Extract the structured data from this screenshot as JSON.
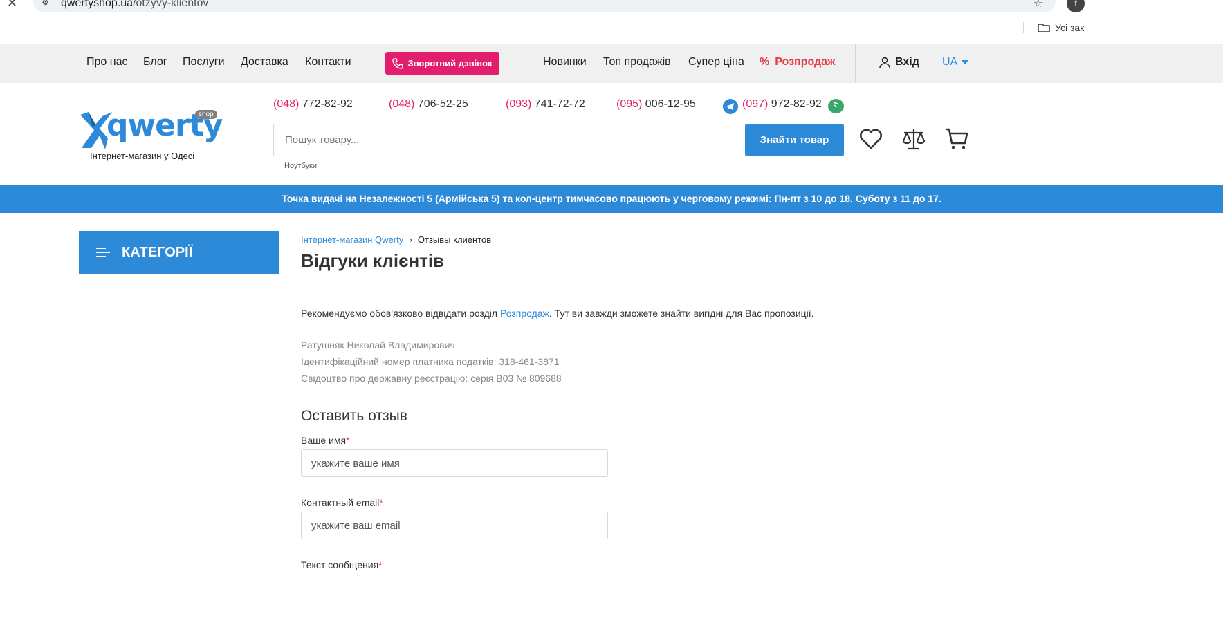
{
  "browser": {
    "url_domain": "qwertyshop.ua",
    "url_path": "/otzyvy-klientov",
    "bookmarks_folder": "Усі зак"
  },
  "topnav": {
    "links": [
      "Про нас",
      "Блог",
      "Послуги",
      "Доставка",
      "Контакти"
    ],
    "callback_label": "Зворотний дзвінок",
    "shop_links": [
      "Новинки",
      "Топ продажів",
      "Супер ціна"
    ],
    "sale_label": "Розпродаж",
    "login_label": "Вхід",
    "lang": "UA"
  },
  "header": {
    "logo_text": "qwerty",
    "logo_badge": "shop",
    "logo_tagline": "Інтернет-магазин у Одесі",
    "phones": [
      {
        "code": "(048)",
        "number": " 772-82-92"
      },
      {
        "code": "(048)",
        "number": " 706-52-25"
      },
      {
        "code": "(093)",
        "number": " 741-72-72"
      },
      {
        "code": "(095)",
        "number": " 006-12-95"
      },
      {
        "code": "(097)",
        "number": " 972-82-92"
      }
    ],
    "search_placeholder": "Пошук товару...",
    "search_button": "Знайти товар",
    "search_hint": "Ноутбуки"
  },
  "banner": "Точка видачі на Незалежності 5 (Армійська 5) та кол-центр тимчасово працюють у черговому режимі: Пн-пт з 10 до 18. Суботу з 11 до 17.",
  "sidebar": {
    "categories_label": "КАТЕГОРІЇ"
  },
  "main": {
    "breadcrumb_home": "Інтернет-магазин Qwerty",
    "breadcrumb_current": "Отзывы клиентов",
    "title": "Відгуки клієнтів",
    "rec_before": "Рекомендуємо обов'язково відвідати розділ ",
    "rec_link": "Розпродаж",
    "rec_after": ". Тут ви завжди зможете знайти вигідні для Вас пропозиції.",
    "info_lines": [
      "Ратушняк Николай Владимирович",
      "Ідентифікаційний номер платника податків: 318-461-3871",
      "Свідоцтво про державну реєстрацію: серія В03 № 809688"
    ]
  },
  "form": {
    "title": "Оставить отзыв",
    "name_label": "Ваше имя",
    "name_placeholder": "укажите ваше имя",
    "email_label": "Контактный email",
    "email_placeholder": "укажите ваш email",
    "message_label": "Текст сообщения",
    "required_mark": "*"
  },
  "colors": {
    "accent": "#2d8ad8",
    "callback": "#e31e6d",
    "sale": "#e63b4b"
  }
}
